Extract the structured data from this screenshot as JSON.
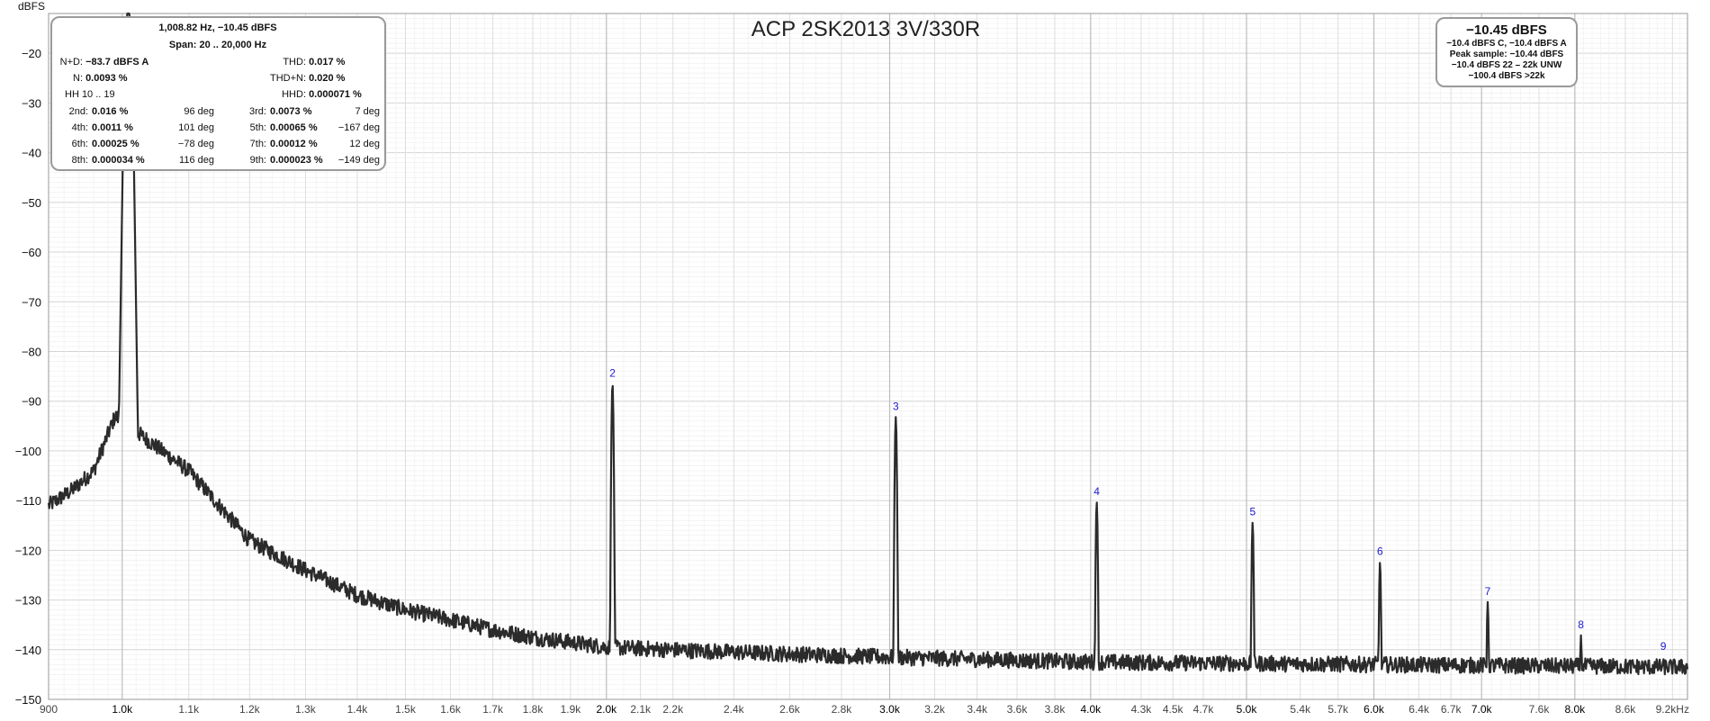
{
  "chart_data": {
    "type": "line",
    "title": "ACP 2SK2013 3V/330R",
    "xlabel": "",
    "ylabel": "dBFS",
    "x_scale": "log",
    "xlim": [
      900,
      9400
    ],
    "ylim": [
      -150,
      -12
    ],
    "grid": true,
    "y_ticks": [
      -20,
      -30,
      -40,
      -50,
      -60,
      -70,
      -80,
      -90,
      -100,
      -110,
      -120,
      -130,
      -140,
      -150
    ],
    "x_ticks": [
      {
        "v": 900,
        "label": "900",
        "major": false
      },
      {
        "v": 1000,
        "label": "1.0k",
        "major": true
      },
      {
        "v": 1100,
        "label": "1.1k",
        "major": false
      },
      {
        "v": 1200,
        "label": "1.2k",
        "major": false
      },
      {
        "v": 1300,
        "label": "1.3k",
        "major": false
      },
      {
        "v": 1400,
        "label": "1.4k",
        "major": false
      },
      {
        "v": 1500,
        "label": "1.5k",
        "major": false
      },
      {
        "v": 1600,
        "label": "1.6k",
        "major": false
      },
      {
        "v": 1700,
        "label": "1.7k",
        "major": false
      },
      {
        "v": 1800,
        "label": "1.8k",
        "major": false
      },
      {
        "v": 1900,
        "label": "1.9k",
        "major": false
      },
      {
        "v": 2000,
        "label": "2.0k",
        "major": true
      },
      {
        "v": 2100,
        "label": "2.1k",
        "major": false
      },
      {
        "v": 2200,
        "label": "2.2k",
        "major": false
      },
      {
        "v": 2400,
        "label": "2.4k",
        "major": false
      },
      {
        "v": 2600,
        "label": "2.6k",
        "major": false
      },
      {
        "v": 2800,
        "label": "2.8k",
        "major": false
      },
      {
        "v": 3000,
        "label": "3.0k",
        "major": true
      },
      {
        "v": 3200,
        "label": "3.2k",
        "major": false
      },
      {
        "v": 3400,
        "label": "3.4k",
        "major": false
      },
      {
        "v": 3600,
        "label": "3.6k",
        "major": false
      },
      {
        "v": 3800,
        "label": "3.8k",
        "major": false
      },
      {
        "v": 4000,
        "label": "4.0k",
        "major": true
      },
      {
        "v": 4300,
        "label": "4.3k",
        "major": false
      },
      {
        "v": 4500,
        "label": "4.5k",
        "major": false
      },
      {
        "v": 4700,
        "label": "4.7k",
        "major": false
      },
      {
        "v": 5000,
        "label": "5.0k",
        "major": true
      },
      {
        "v": 5400,
        "label": "5.4k",
        "major": false
      },
      {
        "v": 5700,
        "label": "5.7k",
        "major": false
      },
      {
        "v": 6000,
        "label": "6.0k",
        "major": true
      },
      {
        "v": 6400,
        "label": "6.4k",
        "major": false
      },
      {
        "v": 6700,
        "label": "6.7k",
        "major": false
      },
      {
        "v": 7000,
        "label": "7.0k",
        "major": true
      },
      {
        "v": 7600,
        "label": "7.6k",
        "major": false
      },
      {
        "v": 8000,
        "label": "8.0k",
        "major": true
      },
      {
        "v": 8600,
        "label": "8.6k",
        "major": false
      },
      {
        "v": 9200,
        "label": "9.2kHz",
        "major": false
      }
    ],
    "fundamental": {
      "freq": 1008.82,
      "level": -10.45
    },
    "noise_floor": [
      {
        "x": 900,
        "y": -111
      },
      {
        "x": 930,
        "y": -108
      },
      {
        "x": 960,
        "y": -104
      },
      {
        "x": 990,
        "y": -93
      },
      {
        "x": 1100,
        "y": -104
      },
      {
        "x": 1200,
        "y": -118
      },
      {
        "x": 1300,
        "y": -124
      },
      {
        "x": 1400,
        "y": -129
      },
      {
        "x": 1500,
        "y": -132
      },
      {
        "x": 1600,
        "y": -134
      },
      {
        "x": 1700,
        "y": -136
      },
      {
        "x": 1800,
        "y": -137.5
      },
      {
        "x": 1900,
        "y": -138.5
      },
      {
        "x": 2000,
        "y": -139.5
      },
      {
        "x": 2400,
        "y": -140.5
      },
      {
        "x": 3000,
        "y": -141.5
      },
      {
        "x": 4000,
        "y": -142.5
      },
      {
        "x": 6000,
        "y": -143
      },
      {
        "x": 9400,
        "y": -143.5
      }
    ],
    "harmonics": [
      {
        "label": "2",
        "freq": 2017.6,
        "level": -86.5
      },
      {
        "label": "3",
        "freq": 3026.5,
        "level": -93.2
      },
      {
        "label": "4",
        "freq": 4035.3,
        "level": -110.3
      },
      {
        "label": "5",
        "freq": 5044.1,
        "level": -114.4
      },
      {
        "label": "6",
        "freq": 6052.9,
        "level": -122.4
      },
      {
        "label": "7",
        "freq": 7061.7,
        "level": -130.4
      },
      {
        "label": "8",
        "freq": 8070.6,
        "level": -137.1
      },
      {
        "label": "9",
        "freq": 9079.4,
        "level": -141.5
      }
    ]
  },
  "measurements": {
    "header1": "1,008.82 Hz, −10.45 dBFS",
    "header2": "Span: 20 .. 20,000 Hz",
    "nd_label": "N+D:",
    "nd_value": "−83.7 dBFS A",
    "thd_label": "THD:",
    "thd_value": "0.017 %",
    "n_label": "N:",
    "n_value": "0.0093 %",
    "thdn_label": "THD+N:",
    "thdn_value": "0.020 %",
    "hh_label": "HH 10 .. 19",
    "hhd_label": "HHD:",
    "hhd_value": "0.000071 %",
    "harmonic_rows": [
      {
        "l1": "2nd:",
        "v1": "0.016 %",
        "p1": "96 deg",
        "l2": "3rd:",
        "v2": "0.0073 %",
        "p2": "7 deg"
      },
      {
        "l1": "4th:",
        "v1": "0.0011 %",
        "p1": "101 deg",
        "l2": "5th:",
        "v2": "0.00065 %",
        "p2": "−167 deg"
      },
      {
        "l1": "6th:",
        "v1": "0.00025 %",
        "p1": "−78 deg",
        "l2": "7th:",
        "v2": "0.00012 %",
        "p2": "12 deg"
      },
      {
        "l1": "8th:",
        "v1": "0.000034 %",
        "p1": "116 deg",
        "l2": "9th:",
        "v2": "0.000023 %",
        "p2": "−149 deg"
      }
    ]
  },
  "level": {
    "main": "−10.45 dBFS",
    "line1": "−10.4 dBFS C, −10.4 dBFS A",
    "line2": "Peak sample: −10.44 dBFS",
    "line3": "−10.4 dBFS 22 – 22k UNW",
    "line4": "−100.4 dBFS >22k"
  },
  "colors": {
    "trace": "#2b2b2b",
    "grid": "#e2e2e2",
    "harmonic_label": "#1a1ad0"
  }
}
